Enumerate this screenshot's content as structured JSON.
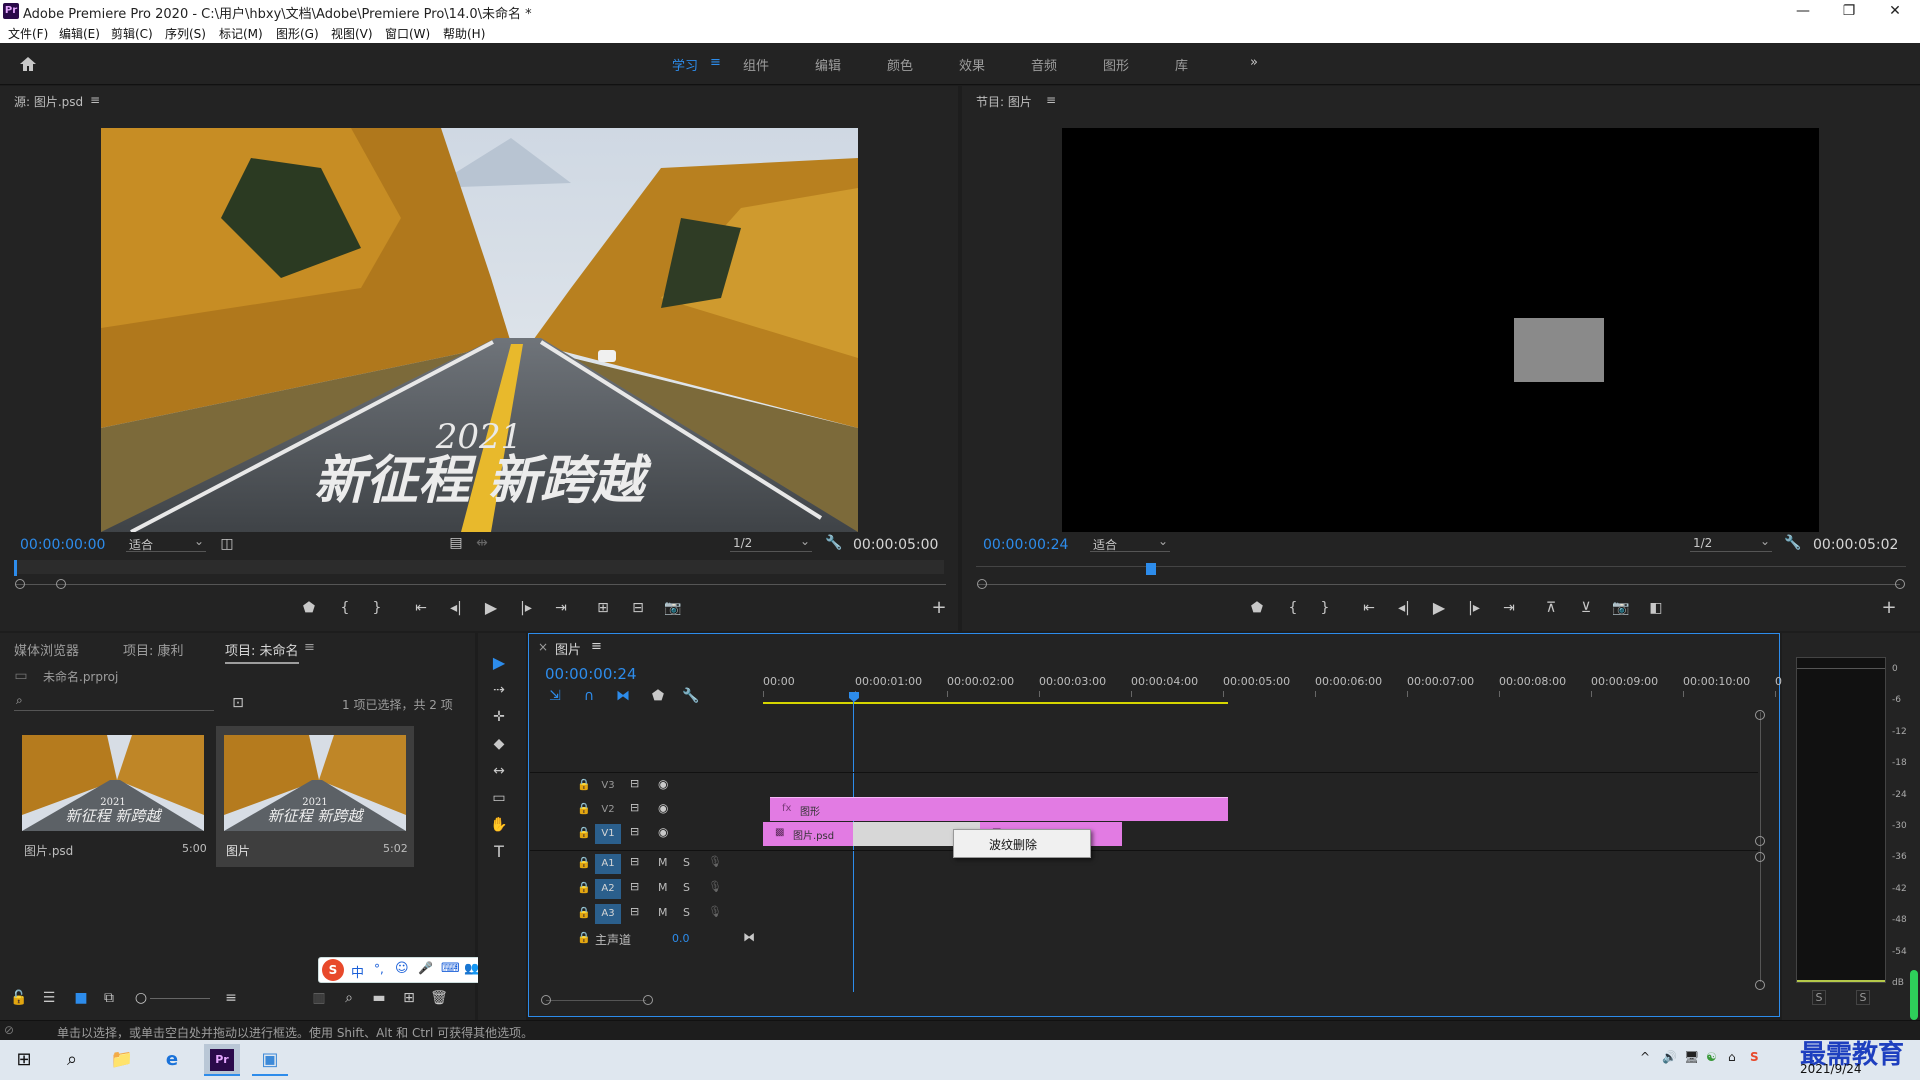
{
  "window": {
    "title": "Adobe Premiere Pro 2020 - C:\\用户\\hbxy\\文档\\Adobe\\Premiere Pro\\14.0\\未命名 *",
    "logo": "Pr",
    "minimize_icon": "—",
    "maximize_icon": "❐",
    "close_icon": "✕"
  },
  "menu": [
    "文件(F)",
    "编辑(E)",
    "剪辑(C)",
    "序列(S)",
    "标记(M)",
    "图形(G)",
    "视图(V)",
    "窗口(W)",
    "帮助(H)"
  ],
  "workspaces": {
    "home_icon": "home-icon",
    "items": [
      "学习",
      "组件",
      "编辑",
      "颜色",
      "效果",
      "音频",
      "图形",
      "库"
    ],
    "active": "学习",
    "more": "»",
    "menu_glyph": "≡"
  },
  "source_monitor": {
    "title": "源: 图片.psd",
    "menu_glyph": "≡",
    "image_year": "2021",
    "image_caption": "新征程 新跨越",
    "timecode": "00:00:00:00",
    "fit": "适合",
    "resolution": "1/2",
    "duration": "00:00:05:00"
  },
  "program_monitor": {
    "title": "节目: 图片",
    "menu_glyph": "≡",
    "timecode": "00:00:00:24",
    "fit": "适合",
    "resolution": "1/2",
    "duration": "00:00:05:02"
  },
  "project_panel": {
    "tabs": [
      "媒体浏览器",
      "项目: 康利",
      "项目: 未命名"
    ],
    "active_tab": "项目: 未命名",
    "menu_glyph": "≡",
    "file": "未命名.prproj",
    "search_placeholder": "",
    "selection_info": "1 项已选择，共 2 项",
    "items": [
      {
        "name": "图片.psd",
        "duration": "5:00",
        "thumb_year": "2021",
        "thumb_caption": "新征程 新跨越"
      },
      {
        "name": "图片",
        "duration": "5:02",
        "thumb_year": "2021",
        "thumb_caption": "新征程 新跨越"
      }
    ]
  },
  "ime_bar": {
    "logo": "S",
    "items": [
      "中",
      "°,",
      "☺",
      "🎤",
      "⌨",
      "👥",
      "👕",
      "▦"
    ]
  },
  "tools": [
    "▶",
    "⇢",
    "✛",
    "◆",
    "↔",
    "▭",
    "✋",
    "T"
  ],
  "timeline": {
    "tab": "图片",
    "close_glyph": "×",
    "menu_glyph": "≡",
    "timecode": "00:00:00:24",
    "ruler": [
      "00:00",
      "00:00:01:00",
      "00:00:02:00",
      "00:00:03:00",
      "00:00:04:00",
      "00:00:05:00",
      "00:00:06:00",
      "00:00:07:00",
      "00:00:08:00",
      "00:00:09:00",
      "00:00:10:00",
      "00"
    ],
    "video_tracks": [
      "V3",
      "V2",
      "V1"
    ],
    "audio_tracks": [
      "A1",
      "A2",
      "A3"
    ],
    "mute": "M",
    "solo": "S",
    "master": "主声道",
    "master_value": "0.0",
    "clips": {
      "v2": "图形",
      "v1": "图片.psd",
      "v1b": "图片"
    },
    "context_menu": "波纹删除"
  },
  "meter": {
    "scale": [
      "0",
      "-6",
      "-12",
      "-18",
      "-24",
      "-30",
      "-36",
      "-42",
      "-48",
      "-54",
      "dB"
    ],
    "solo_left": "S",
    "solo_right": "S"
  },
  "status_bar": {
    "text": "单击以选择，或单击空白处并拖动以进行框选。使用 Shift、Alt 和 Ctrl 可获得其他选项。"
  },
  "taskbar": {
    "date": "2021/9/24",
    "watermark": "最需教育",
    "tray": [
      "^",
      "🔊",
      "🖥",
      "☯",
      "⌂",
      "S"
    ]
  },
  "colors": {
    "accent_blue": "#2d8ceb",
    "clip_pink": "#e27be3",
    "playhead_blue": "#3a7bd5",
    "panel": "#232323"
  }
}
